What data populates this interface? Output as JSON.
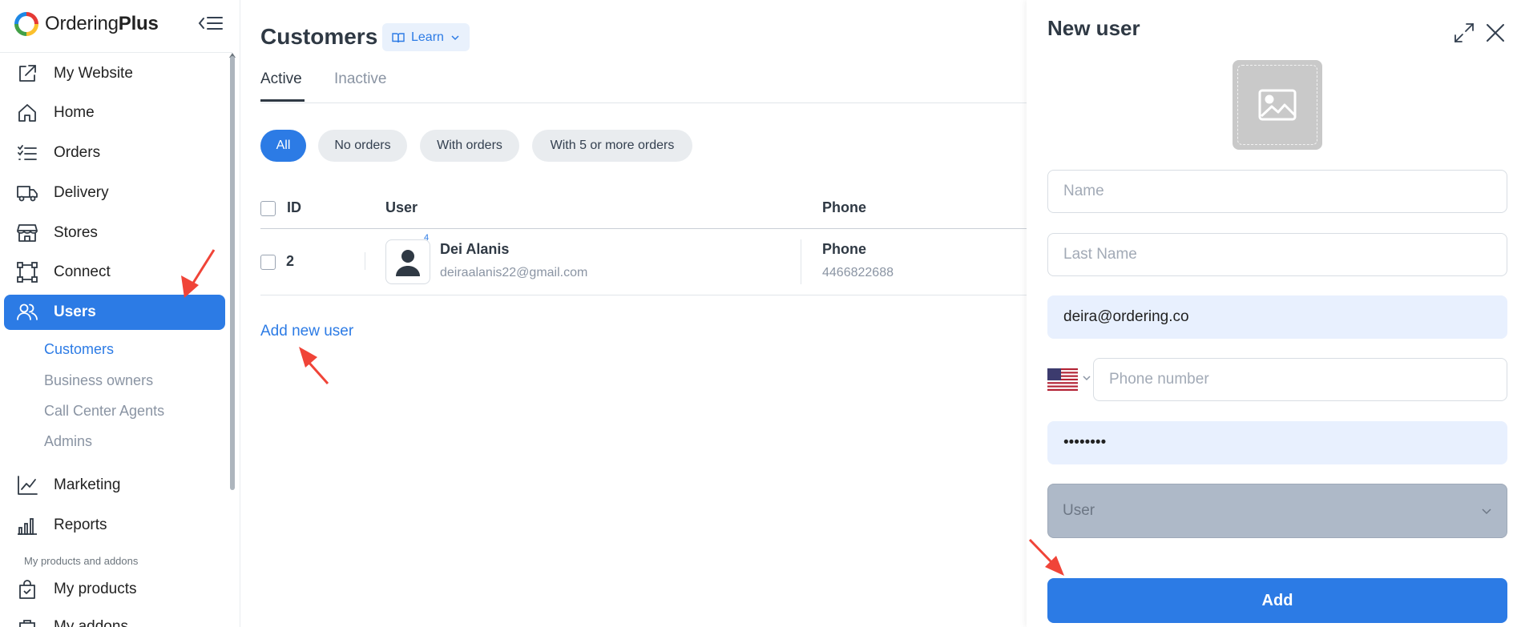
{
  "brand": {
    "name_regular": "Ordering",
    "name_bold": "Plus"
  },
  "sidebar": {
    "items": [
      {
        "label": "My Website",
        "icon": "external-link-icon"
      },
      {
        "label": "Home",
        "icon": "home-icon"
      },
      {
        "label": "Orders",
        "icon": "list-icon"
      },
      {
        "label": "Delivery",
        "icon": "truck-icon"
      },
      {
        "label": "Stores",
        "icon": "store-icon"
      },
      {
        "label": "Connect",
        "icon": "connect-icon"
      },
      {
        "label": "Users",
        "icon": "users-icon"
      },
      {
        "label": "Marketing",
        "icon": "chart-line-icon"
      },
      {
        "label": "Reports",
        "icon": "bar-chart-icon"
      },
      {
        "label": "My products",
        "icon": "shopping-bag-icon"
      },
      {
        "label": "My addons",
        "icon": "addon-icon"
      }
    ],
    "users_sub": [
      "Customers",
      "Business owners",
      "Call Center Agents",
      "Admins"
    ],
    "section_label": "My products and addons"
  },
  "main": {
    "title": "Customers",
    "learn_label": "Learn",
    "tabs": [
      "Active",
      "Inactive"
    ],
    "filters": [
      "All",
      "No orders",
      "With orders",
      "With 5 or more orders"
    ],
    "columns": {
      "id": "ID",
      "user": "User",
      "phone": "Phone"
    },
    "rows": [
      {
        "id": "2",
        "badge": "4",
        "name": "Dei Alanis",
        "email": "deiraalanis22@gmail.com",
        "phone_label": "Phone",
        "phone": "4466822688"
      }
    ],
    "add_link": "Add new user"
  },
  "panel": {
    "title": "New user",
    "name_placeholder": "Name",
    "lastname_placeholder": "Last Name",
    "email_value": "deira@ordering.co",
    "phone_placeholder": "Phone number",
    "password_value": "password",
    "role_value": "User",
    "add_label": "Add"
  },
  "colors": {
    "accent": "#2c7be5",
    "annotation_arrow": "#f04438"
  }
}
